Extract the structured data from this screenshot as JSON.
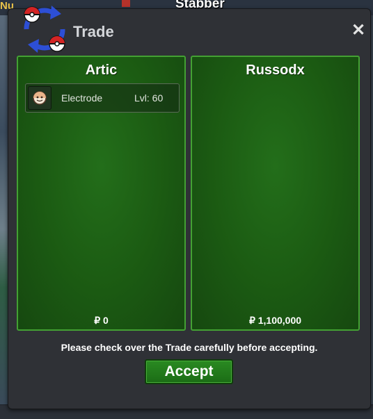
{
  "background": {
    "left_name": "Nu",
    "player_name": "Stabber"
  },
  "window": {
    "title": "Trade",
    "close_label": "✕"
  },
  "left_panel": {
    "trainer": "Artic",
    "items": [
      {
        "pokemon": "Electrode",
        "level": "Lvl: 60"
      }
    ],
    "money": "₽ 0"
  },
  "right_panel": {
    "trainer": "Russodx",
    "items": [],
    "money": "₽ 1,100,000"
  },
  "notice": "Please check over the Trade carefully before accepting.",
  "accept_label": "Accept"
}
